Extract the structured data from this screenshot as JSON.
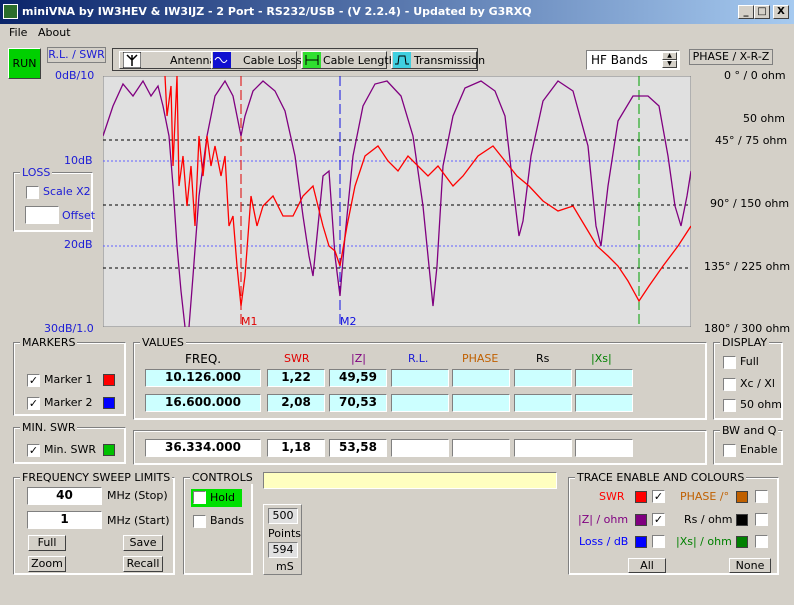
{
  "window": {
    "title": "miniVNA by IW3HEV & IW3IJZ - 2 Port - RS232/USB -  (V 2.2.4) - Updated by G3RXQ",
    "min": "_",
    "max": "□",
    "close": "X"
  },
  "menu": {
    "file": "File",
    "about": "About"
  },
  "toolbar": {
    "run": "RUN",
    "rl_swr": "R.L. / SWR",
    "antenna": "Antenna",
    "cable_loss": "Cable Loss",
    "cable_length": "Cable Length",
    "transmission": "Transmission",
    "band_select": "HF Bands",
    "phase_xrz": "PHASE / X-R-Z"
  },
  "axis": {
    "left": [
      "0dB/10",
      "10dB",
      "20dB",
      "30dB/1.0"
    ],
    "right": [
      "0 ° / 0 ohm",
      "50 ohm",
      "45° / 75 ohm",
      "90° / 150 ohm",
      "135° / 225 ohm",
      "180° / 300 ohm"
    ]
  },
  "chart_data": {
    "type": "line",
    "markers": [
      {
        "name": "M1",
        "color": "#e00000"
      },
      {
        "name": "M2",
        "color": "#1010e0"
      }
    ],
    "series": [
      {
        "name": "SWR",
        "color": "#ff0000"
      },
      {
        "name": "|Z| / ohm",
        "color": "#800080"
      }
    ]
  },
  "loss": {
    "title": "LOSS",
    "scale": "Scale X2",
    "offset_label": "Offset",
    "offset_value": ""
  },
  "markers": {
    "title": "MARKERS",
    "m1": "Marker 1",
    "m2": "Marker 2",
    "m1_color": "#ff0000",
    "m2_color": "#0000ff"
  },
  "values": {
    "title": "VALUES",
    "headers": {
      "freq": "FREQ.",
      "swr": "SWR",
      "z": "|Z|",
      "rl": "R.L.",
      "phase": "PHASE",
      "rs": "Rs",
      "xs": "|Xs|"
    },
    "row1": {
      "freq": "10.126.000",
      "swr": "1,22",
      "z": "49,59"
    },
    "row2": {
      "freq": "16.600.000",
      "swr": "2,08",
      "z": "70,53"
    },
    "min": {
      "freq": "36.334.000",
      "swr": "1,18",
      "z": "53,58"
    }
  },
  "minswr": {
    "title": "MIN. SWR",
    "label": "Min. SWR",
    "color": "#00c000"
  },
  "display": {
    "title": "DISPLAY",
    "full": "Full",
    "xcxl": "Xc / Xl",
    "ohm50": "50 ohm"
  },
  "bwq": {
    "title": "BW and Q",
    "enable": "Enable"
  },
  "sweep": {
    "title": "FREQUENCY SWEEP LIMITS",
    "stop_value": "40",
    "stop_unit": "MHz (Stop)",
    "start_value": "1",
    "start_unit": "MHz (Start)",
    "full": "Full",
    "save": "Save",
    "zoom": "Zoom",
    "recall": "Recall"
  },
  "controls": {
    "title": "CONTROLS",
    "hold": "Hold",
    "bands": "Bands",
    "points_value": "500",
    "points_label": "Points",
    "ms_value": "594",
    "ms_label": "mS",
    "status": ""
  },
  "trace": {
    "title": "TRACE ENABLE AND COLOURS",
    "swr": "SWR",
    "z": "|Z| / ohm",
    "loss": "Loss / dB",
    "phase": "PHASE /°",
    "rs": "Rs / ohm",
    "xs": "|Xs| / ohm",
    "all": "All",
    "none": "None",
    "colors": {
      "swr": "#ff0000",
      "z": "#800080",
      "loss": "#0000ff",
      "phase": "#c06000",
      "rs": "#000000",
      "xs": "#008000"
    }
  },
  "checks": {
    "x": "✓"
  }
}
